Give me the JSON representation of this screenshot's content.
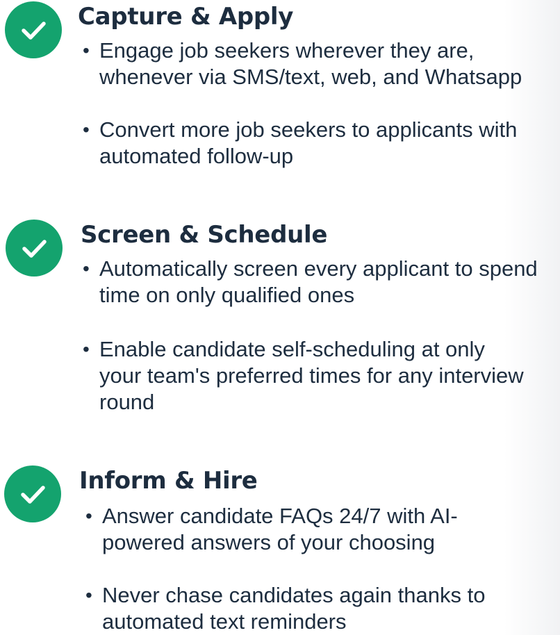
{
  "colors": {
    "accent": "#14a36e",
    "text": "#1d2d3f"
  },
  "icon": "checkmark-circle-icon",
  "sections": [
    {
      "title": "Capture & Apply",
      "bullets": [
        "Engage job seekers wherever they are, whenever via SMS/text, web, and Whatsapp",
        "Convert more job seekers to applicants with automated follow-up"
      ]
    },
    {
      "title": "Screen & Schedule",
      "bullets": [
        "Automatically screen every applicant to spend time on only qualified ones",
        "Enable candidate self-scheduling at only your team's preferred times for any interview round"
      ]
    },
    {
      "title": "Inform & Hire",
      "bullets": [
        "Answer candidate FAQs 24/7 with AI-powered answers of your choosing",
        "Never chase candidates again thanks to automated text reminders"
      ]
    }
  ]
}
